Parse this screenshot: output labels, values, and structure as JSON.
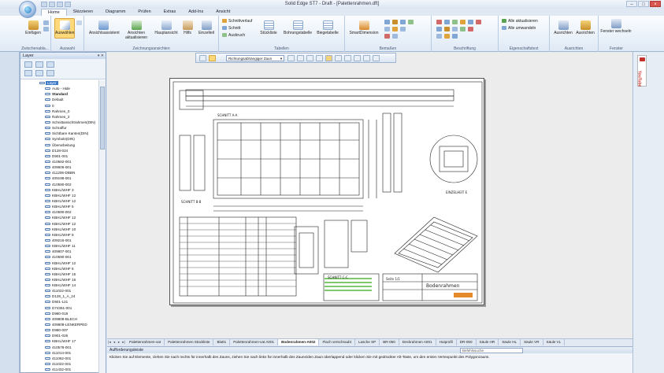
{
  "window": {
    "title": "Solid Edge ST7 - Draft - [Palettenrahmen.dft]",
    "controls": [
      "–",
      "□",
      "×"
    ]
  },
  "ribbon": {
    "tabs": [
      "Home",
      "Skizzieren",
      "Diagramm",
      "Prüfen",
      "Extras",
      "Add-Ins",
      "Ansicht"
    ],
    "active_tab": "Home",
    "groups": [
      {
        "label": "Zwischenabla...",
        "buttons": [
          "Einfügen"
        ]
      },
      {
        "label": "Auswahl",
        "buttons": [
          "Auswählen"
        ]
      },
      {
        "label": "Zeichnungsansichten",
        "buttons": [
          "Ansichtsassistent",
          "Ansichten aktualisieren",
          "Hauptansicht",
          "Hilfs",
          "Einzelteil"
        ]
      },
      {
        "label": "Tabellen",
        "buttons": [
          "Schnittverlauf",
          "Schnitt",
          "Ausbruch",
          "Stückliste",
          "Bohrungstabelle",
          "Biegetabelle"
        ]
      },
      {
        "label": "Bemaßen",
        "buttons": [
          "SmartDimension"
        ]
      },
      {
        "label": "Beschriftung",
        "buttons": []
      },
      {
        "label": "Eigenschaftstext",
        "buttons": [
          "Alle aktualisieren",
          "Alle umwandeln"
        ]
      },
      {
        "label": "Ausrichten",
        "buttons": [
          "Ausrichten",
          "Ausrichten"
        ]
      },
      {
        "label": "Fenster",
        "buttons": [
          "Fenster wechseln"
        ]
      }
    ]
  },
  "layer_panel": {
    "title": "Layer",
    "header_buttons": "▾ ✕",
    "root": "Layer",
    "items": [
      "Auto - Hide",
      "Standard",
      "Default",
      "0",
      "Rahmen_0",
      "Rahmen_2",
      "Schnittansichtrahmen(DIN)",
      "Schraffur",
      "Sichtbare Kanten(DIN)",
      "Symbole(DIN)",
      "Überarbeitung",
      "D128-024",
      "D901-001",
      "410582-001",
      "409606-001",
      "411206-DBBN",
      "409198-001",
      "410590-002",
      "KBHL/WHF 3",
      "KBHL/WHF 12",
      "KBHL/WHF 12",
      "KBHL/WHF 5",
      "410590-002",
      "KBHL/WHF 12",
      "KBHL/WHF 12",
      "KBHL/WHF 10",
      "KBHL/WHF 9",
      "409216-001",
      "KBHL/WHF 11",
      "409807-001",
      "410590-001",
      "KBHL/WHF 12",
      "KBHL/WHF 6",
      "KBHL/WHF 15",
      "KBHL/WHF 16",
      "KBHL/WHF 14",
      "411022-001",
      "D128_1_A_24",
      "D901-121",
      "D74361-001",
      "D980-018",
      "409808-BLECH",
      "409808-LENKERPED",
      "D980-007",
      "D901-026",
      "KBHL/WHF 17",
      "410578-001",
      "411014-001",
      "411062-001",
      "411022-001",
      "411432-001"
    ],
    "bold_items": [
      "Standard"
    ]
  },
  "canvas_toolbar": {
    "select_value": "Richtungsabhängiger Zaun"
  },
  "sheet": {
    "labels": [
      "SCHNITT A-A",
      "SCHNITT B-B",
      "SCHNITT C-C",
      "EINZELHEIT E",
      "Bodenrahmen",
      "Seite 1/1"
    ]
  },
  "sheet_tabs": [
    "Palettenrahmen-vat",
    "Palettenrahmen Stückliste",
    "Blatt1",
    "Palettenrahmen-vat A001",
    "Bodenrahmen-A002",
    "Flach verschraubt",
    "Lasche SP",
    "BR-050",
    "Deckrahmen A001",
    "Hutprofil",
    "DR-050",
    "Säule HR",
    "Säule HL",
    "Säule VR",
    "Säule VL"
  ],
  "active_sheet_tab": "Bodenrahmen-A002",
  "prompt": {
    "title": "Aufforderungsleiste",
    "input_placeholder": "Befehlssuche",
    "text": "Klicken Sie auf Elemente, ziehen Sie nach rechts für innerhalb des Zauns, ziehen Sie nach links für innerhalb des Zauns/den Zaun überlappend oder klicken Sie mit gedrückter Alt-Taste, um den ersten Vertexpunkt des Polygonzauns."
  },
  "right_panel": {
    "youtube_label": "YouTube"
  },
  "colors": {
    "ribbon_bg": "#dfe9f5",
    "accent_selected": "#ffd979",
    "layer_selected": "#3c78c8",
    "youtube_red": "#c4302b"
  }
}
